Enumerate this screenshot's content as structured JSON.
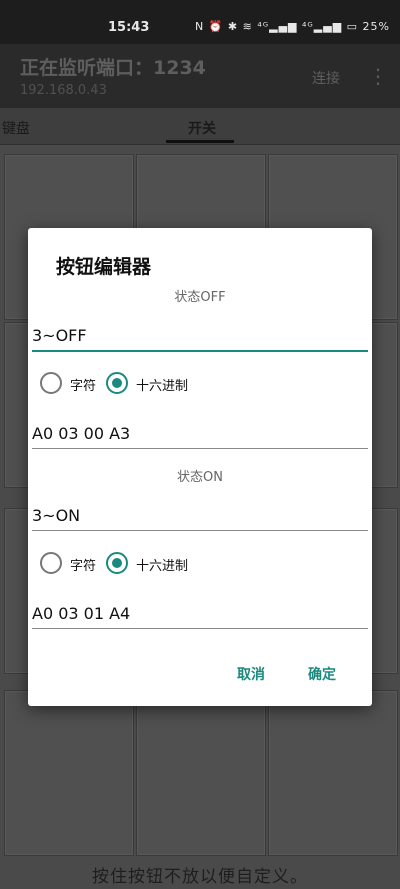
{
  "status_bar": {
    "time": "15:43",
    "icons_text": "N ⏰ ✱ ≋ ⁴ᴳ▂▄▆ ⁴ᴳ▂▄▆ ▭ 25%",
    "battery": "25%"
  },
  "app_bar": {
    "title": "正在监听端口：1234",
    "subtitle": "192.168.0.43",
    "connect_label": "连接",
    "more_icon": "⋮"
  },
  "tabs": [
    {
      "label": "键盘",
      "selected": false
    },
    {
      "label": "开关",
      "selected": true
    }
  ],
  "hint": "按住按钮不放以便自定义。",
  "dialog": {
    "title": "按钮编辑器",
    "off": {
      "state_label": "状态OFF",
      "name": "3~OFF",
      "radio_char": "字符",
      "radio_hex": "十六进制",
      "selected": "hex",
      "value": "A0 03 00 A3"
    },
    "on": {
      "state_label": "状态ON",
      "name": "3~ON",
      "radio_char": "字符",
      "radio_hex": "十六进制",
      "selected": "hex",
      "value": "A0 03 01 A4"
    },
    "cancel_label": "取消",
    "confirm_label": "确定"
  },
  "colors": {
    "accent": "#1a8a7e",
    "scrim": "#4a4a4a"
  }
}
